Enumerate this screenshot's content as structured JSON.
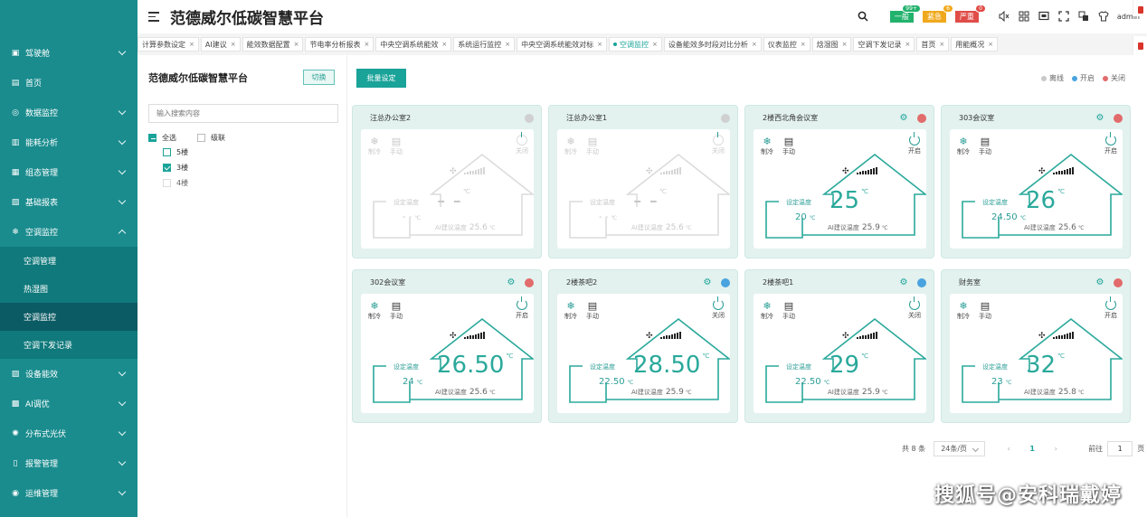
{
  "app": {
    "title": "范德威尔低碳智慧平台"
  },
  "sidebar": {
    "items": [
      {
        "label": "驾驶舱",
        "icon": "dashboard-icon"
      },
      {
        "label": "首页",
        "icon": "home-icon"
      },
      {
        "label": "数据监控",
        "icon": "monitor-icon"
      },
      {
        "label": "能耗分析",
        "icon": "bar-chart-icon"
      },
      {
        "label": "组态管理",
        "icon": "config-icon"
      },
      {
        "label": "基础报表",
        "icon": "report-icon"
      },
      {
        "label": "空调监控",
        "icon": "snowflake-icon"
      },
      {
        "label": "设备能效",
        "icon": "efficiency-icon"
      },
      {
        "label": "AI调优",
        "icon": "ai-icon"
      },
      {
        "label": "分布式光伏",
        "icon": "solar-icon"
      },
      {
        "label": "报警管理",
        "icon": "alarm-icon"
      },
      {
        "label": "运维管理",
        "icon": "maintenance-icon"
      }
    ],
    "sub_items": [
      "空调管理",
      "热湿图",
      "空调监控",
      "空调下发记录"
    ]
  },
  "header": {
    "alarms": [
      {
        "label": "一般",
        "count": "99+",
        "color": "#23b26d"
      },
      {
        "label": "紧急",
        "count": "6",
        "color": "#f0a91c"
      },
      {
        "label": "严重",
        "count": "0",
        "color": "#e04d48"
      }
    ],
    "user": "admin"
  },
  "tabs": [
    {
      "label": "计算参数设定",
      "active": false
    },
    {
      "label": "AI建议",
      "active": false
    },
    {
      "label": "能效数据配置",
      "active": false
    },
    {
      "label": "节电率分析报表",
      "active": false
    },
    {
      "label": "中央空调系统能效",
      "active": false
    },
    {
      "label": "系统运行监控",
      "active": false
    },
    {
      "label": "中央空调系统能效对标",
      "active": false
    },
    {
      "label": "空调监控",
      "active": true
    },
    {
      "label": "设备能效多时段对比分析",
      "active": false
    },
    {
      "label": "仪表监控",
      "active": false
    },
    {
      "label": "焓湿图",
      "active": false
    },
    {
      "label": "空调下发记录",
      "active": false
    },
    {
      "label": "首页",
      "active": false
    },
    {
      "label": "用能概况",
      "active": false
    }
  ],
  "tree": {
    "title": "范德威尔低碳智慧平台",
    "switch_label": "切换",
    "search_placeholder": "输入搜索内容",
    "select_all": "全选",
    "cascade": "级联",
    "floors": [
      "5楼",
      "3楼",
      "4楼"
    ]
  },
  "main": {
    "batch_label": "批量设定",
    "legend": [
      {
        "label": "离线",
        "color": "#c8c8c8"
      },
      {
        "label": "开启",
        "color": "#4aa3df"
      },
      {
        "label": "关闭",
        "color": "#e26b6b"
      }
    ],
    "labels": {
      "mode": "制冷",
      "fan": "手动",
      "set": "设定温度",
      "ai": "AI建议温度",
      "unit": "℃",
      "on": "开启",
      "off": "关闭"
    },
    "cards": [
      {
        "name": "汪总办公室2",
        "status": "offline",
        "power": "关闭",
        "temp": "- -",
        "set": "- -",
        "ai": "25.6"
      },
      {
        "name": "汪总办公室1",
        "status": "offline",
        "power": "关闭",
        "temp": "- -",
        "set": "- -",
        "ai": "25.6"
      },
      {
        "name": "2楼西北角会议室",
        "status": "closed",
        "power": "开启",
        "temp": "25",
        "set": "20",
        "ai": "25.9"
      },
      {
        "name": "303会议室",
        "status": "closed",
        "power": "开启",
        "temp": "26",
        "set": "24.50",
        "ai": "25.6"
      },
      {
        "name": "302会议室",
        "status": "closed",
        "power": "开启",
        "temp": "26.50",
        "set": "24",
        "ai": "25.6"
      },
      {
        "name": "2楼茶吧2",
        "status": "on",
        "power": "关闭",
        "temp": "28.50",
        "set": "22.50",
        "ai": "25.9"
      },
      {
        "name": "2楼茶吧1",
        "status": "on",
        "power": "关闭",
        "temp": "29",
        "set": "22.50",
        "ai": "25.9"
      },
      {
        "name": "财务室",
        "status": "closed",
        "power": "开启",
        "temp": "32",
        "set": "23",
        "ai": "25.8"
      }
    ]
  },
  "pager": {
    "total": "共 8 条",
    "size": "24条/页",
    "current": "1",
    "goto": "前往",
    "goto_value": "1",
    "page_unit": "页"
  },
  "watermark": "搜狐号@安科瑞戴婷"
}
